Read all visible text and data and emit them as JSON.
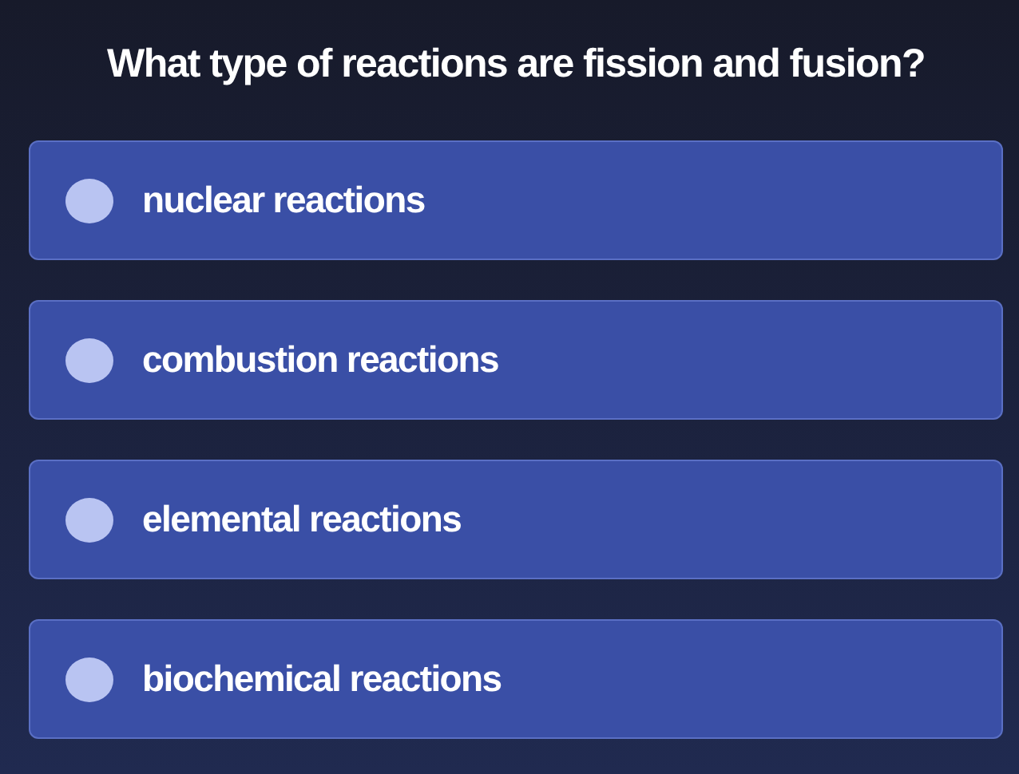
{
  "question": "What type of reactions are fission and fusion?",
  "options": [
    {
      "label": "nuclear reactions",
      "selected": false
    },
    {
      "label": "combustion reactions",
      "selected": false
    },
    {
      "label": "elemental reactions",
      "selected": false
    },
    {
      "label": "biochemical reactions",
      "selected": false
    }
  ]
}
